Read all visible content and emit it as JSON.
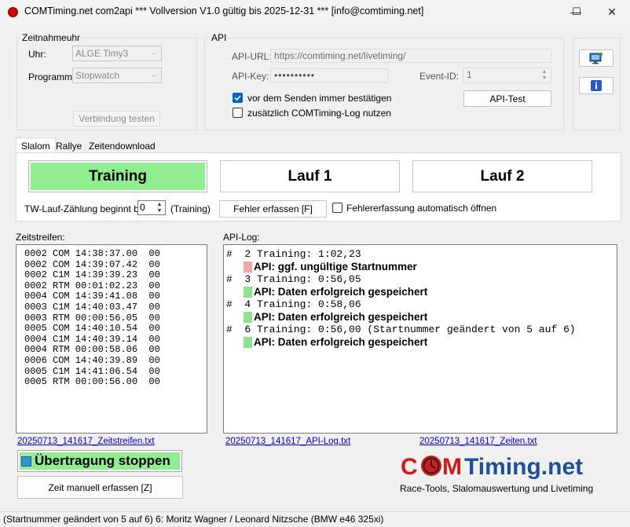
{
  "window": {
    "title": "COMTiming.net com2api *** Vollversion V1.0 gültig bis 2025-12-31 *** [info@comtiming.net]",
    "minimize_glyph": "—",
    "maximize_glyph": "☐",
    "close_glyph": "✕"
  },
  "zeitnahmeuhr": {
    "group_label": "Zeitnahmeuhr",
    "uhr_label": "Uhr:",
    "uhr_value": "ALGE Timy3",
    "programm_label": "Programm:",
    "programm_value": "Stopwatch",
    "test_button": "Verbindung testen"
  },
  "api": {
    "group_label": "API",
    "url_label": "API-URL:",
    "url_value": "https://comtiming.net/livetiming/",
    "key_label": "API-Key:",
    "key_value": "••••••••••",
    "event_label": "Event-ID:",
    "event_value": "1",
    "confirm_label": "vor dem Senden immer bestätigen",
    "confirm_checked": true,
    "log_label": "zusätzlich COMTiming-Log nutzen",
    "log_checked": false,
    "test_button": "API-Test"
  },
  "side_icons": [
    "monitor-add-icon",
    "info-icon"
  ],
  "tabs": [
    {
      "label": "Slalom",
      "selected": true
    },
    {
      "label": "Rallye",
      "selected": false
    },
    {
      "label": "Zeitendownload",
      "selected": false
    }
  ],
  "slalom": {
    "training_button": "Training",
    "lauf1_button": "Lauf 1",
    "lauf2_button": "Lauf 2",
    "tw_label": "TW-Lauf-Zählung beginnt bei:",
    "tw_value": "0",
    "tw_suffix": "(Training)",
    "fehler_button": "Fehler erfassen [F]",
    "fehler_auto_label": "Fehlererfassung automatisch öffnen",
    "fehler_auto_checked": false
  },
  "zeitstreifen": {
    "label": "Zeitstreifen:",
    "lines": [
      "0002 COM 14:38:37.00  00",
      "0002 COM 14:39:07.42  00",
      "0002 C1M 14:39:39.23  00",
      "0002 RTM 00:01:02.23  00",
      "0004 COM 14:39:41.08  00",
      "0003 C1M 14:40:03.47  00",
      "0003 RTM 00:00:56.05  00",
      "0005 COM 14:40:10.54  00",
      "0004 C1M 14:40:39.14  00",
      "0004 RTM 00:00:58.06  00",
      "0006 COM 14:40:39.89  00",
      "0005 C1M 14:41:06.54  00",
      "0005 RTM 00:00:56.00  00"
    ],
    "file_link": "20250713_141617_Zeitstreifen.txt"
  },
  "apilog": {
    "label": "API-Log:",
    "entries": [
      {
        "line": "#  2 Training: 1:02,23",
        "result": "API: ggf. ungültige Startnummer",
        "color": "#f4a7a7"
      },
      {
        "line": "#  3 Training: 0:56,05",
        "result": "API: Daten erfolgreich gespeichert",
        "color": "#8fe38f"
      },
      {
        "line": "#  4 Training: 0:58,06",
        "result": "API: Daten erfolgreich gespeichert",
        "color": "#8fe38f"
      },
      {
        "line": "#  6 Training: 0:56,00 (Startnummer geändert von 5 auf 6)",
        "result": "API: Daten erfolgreich gespeichert",
        "color": "#8fe38f"
      }
    ],
    "file_link": "20250713_141617_API-Log.txt",
    "zeiten_link": "20250713_141617_Zeiten.txt"
  },
  "bottom": {
    "stop_button": "Übertragung stoppen",
    "manual_button": "Zeit manuell erfassen [Z]"
  },
  "logo": {
    "brand": "COMTiming.net",
    "tagline": "Race-Tools, Slalomauswertung und Livetiming"
  },
  "colors": {
    "active_green": "#90ee90",
    "logo_red": "#d11a1a",
    "logo_blue": "#1f4f9a"
  },
  "status": "(Startnummer geändert von 5 auf 6) 6: Moritz  Wagner / Leonard Nitzsche (BMW e46 325xi)"
}
